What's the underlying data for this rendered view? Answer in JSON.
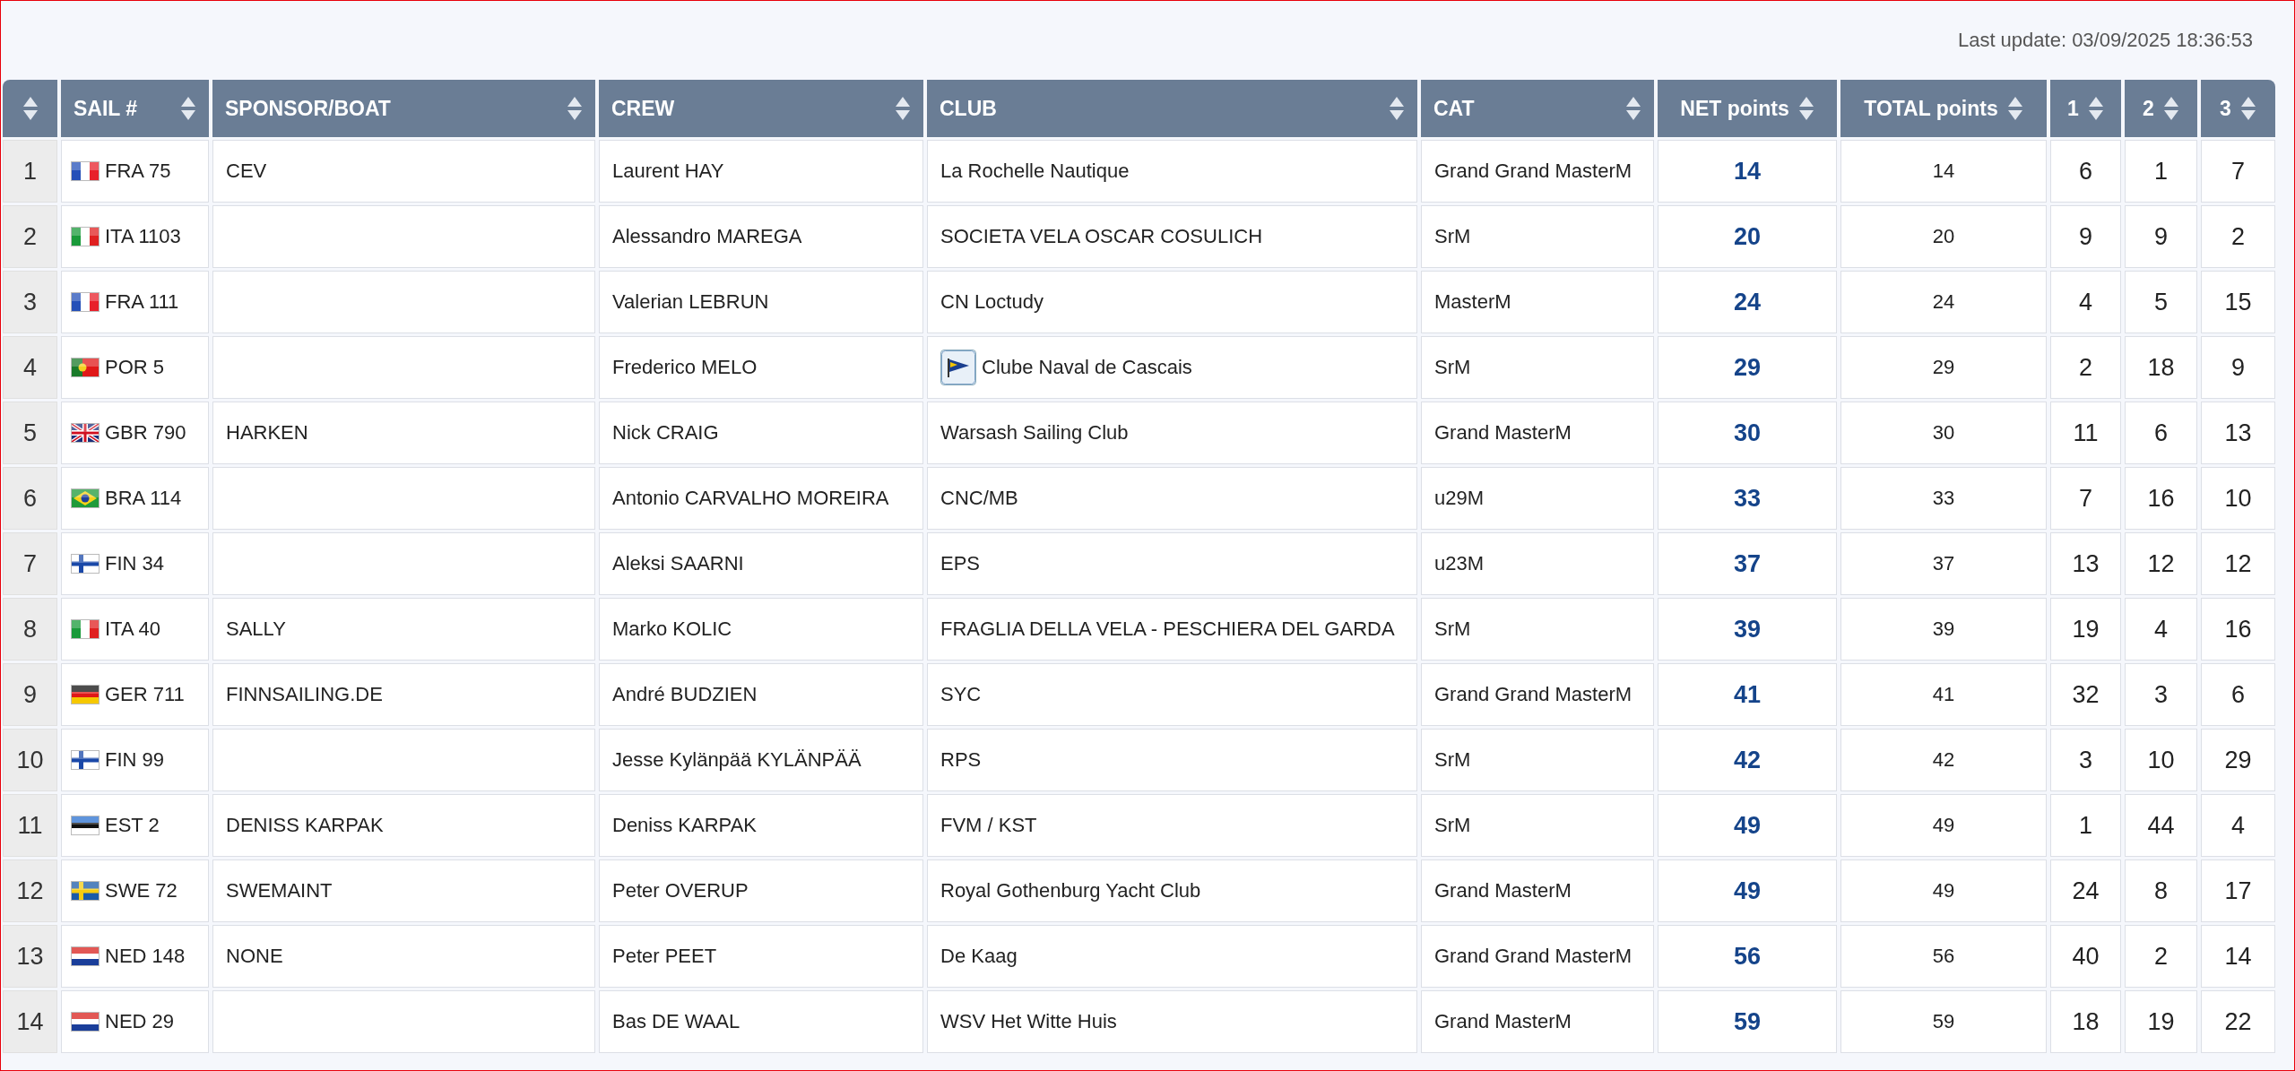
{
  "last_update": "Last update: 03/09/2025 18:36:53",
  "columns": [
    {
      "kind": "rank"
    },
    {
      "kind": "text",
      "label": "SAIL #"
    },
    {
      "kind": "text",
      "label": "SPONSOR/BOAT"
    },
    {
      "kind": "text",
      "label": "CREW"
    },
    {
      "kind": "text",
      "label": "CLUB"
    },
    {
      "kind": "text",
      "label": "CAT"
    },
    {
      "kind": "number",
      "label": "NET points"
    },
    {
      "kind": "number",
      "label": "TOTAL points"
    },
    {
      "kind": "number",
      "label": "1"
    },
    {
      "kind": "number",
      "label": "2"
    },
    {
      "kind": "number",
      "label": "3"
    }
  ],
  "rows": [
    {
      "rank": "1",
      "flag": {
        "kind": "fr"
      },
      "sail": "FRA 75",
      "sponsor": "CEV",
      "crew": "Laurent HAY",
      "club": "La Rochelle Nautique",
      "cat": "Grand Grand MasterM",
      "net": "14",
      "total": "14",
      "races": [
        "6",
        "1",
        "7"
      ]
    },
    {
      "rank": "2",
      "flag": {
        "kind": "it"
      },
      "sail": "ITA 1103",
      "crew": "Alessandro MAREGA",
      "club": "SOCIETA VELA OSCAR COSULICH",
      "cat": "SrM",
      "net": "20",
      "total": "20",
      "races": [
        "9",
        "9",
        "2"
      ]
    },
    {
      "rank": "3",
      "flag": {
        "kind": "fr"
      },
      "sail": "FRA 111",
      "crew": "Valerian LEBRUN",
      "club": "CN Loctudy",
      "cat": "MasterM",
      "net": "24",
      "total": "24",
      "races": [
        "4",
        "5",
        "15"
      ]
    },
    {
      "rank": "4",
      "flag": {
        "kind": "pt"
      },
      "sail": "POR 5",
      "crew": "Frederico MELO",
      "club": "Clube Naval de Cascais",
      "club_logo": true,
      "cat": "SrM",
      "net": "29",
      "total": "29",
      "races": [
        "2",
        "18",
        "9"
      ]
    },
    {
      "rank": "5",
      "flag": {
        "kind": "gb"
      },
      "sail": "GBR 790",
      "sponsor": "HARKEN",
      "crew": "Nick CRAIG",
      "club": "Warsash Sailing Club",
      "cat": "Grand MasterM",
      "net": "30",
      "total": "30",
      "races": [
        "11",
        "6",
        "13"
      ]
    },
    {
      "rank": "6",
      "flag": {
        "kind": "br"
      },
      "sail": "BRA 114",
      "crew": "Antonio CARVALHO MOREIRA",
      "club": "CNC/MB",
      "cat": "u29M",
      "net": "33",
      "total": "33",
      "races": [
        "7",
        "16",
        "10"
      ]
    },
    {
      "rank": "7",
      "flag": {
        "kind": "fi"
      },
      "sail": "FIN 34",
      "crew": "Aleksi SAARNI",
      "club": "EPS",
      "cat": "u23M",
      "net": "37",
      "total": "37",
      "races": [
        "13",
        "12",
        "12"
      ]
    },
    {
      "rank": "8",
      "flag": {
        "kind": "it"
      },
      "sail": "ITA 40",
      "sponsor": "SALLY",
      "crew": "Marko KOLIC",
      "club": "FRAGLIA DELLA VELA - PESCHIERA DEL GARDA",
      "cat": "SrM",
      "net": "39",
      "total": "39",
      "races": [
        "19",
        "4",
        "16"
      ]
    },
    {
      "rank": "9",
      "flag": {
        "kind": "de"
      },
      "sail": "GER 711",
      "sponsor": "FINNSAILING.DE",
      "crew": "André BUDZIEN",
      "club": "SYC",
      "cat": "Grand Grand MasterM",
      "net": "41",
      "total": "41",
      "races": [
        "32",
        "3",
        "6"
      ]
    },
    {
      "rank": "10",
      "flag": {
        "kind": "fi"
      },
      "sail": "FIN 99",
      "crew": "Jesse Kylänpää KYLÄNPÄÄ",
      "club": "RPS",
      "cat": "SrM",
      "net": "42",
      "total": "42",
      "races": [
        "3",
        "10",
        "29"
      ]
    },
    {
      "rank": "11",
      "flag": {
        "kind": "ee"
      },
      "sail": "EST 2",
      "sponsor": "DENISS KARPAK",
      "crew": "Deniss KARPAK",
      "club": "FVM / KST",
      "cat": "SrM",
      "net": "49",
      "total": "49",
      "races": [
        "1",
        "44",
        "4"
      ]
    },
    {
      "rank": "12",
      "flag": {
        "kind": "se"
      },
      "sail": "SWE 72",
      "sponsor": "SWEMAINT",
      "crew": "Peter OVERUP",
      "club": "Royal Gothenburg Yacht Club",
      "cat": "Grand MasterM",
      "net": "49",
      "total": "49",
      "races": [
        "24",
        "8",
        "17"
      ]
    },
    {
      "rank": "13",
      "flag": {
        "kind": "nl"
      },
      "sail": "NED 148",
      "sponsor": "NONE",
      "crew": "Peter PEET",
      "club": "De Kaag",
      "cat": "Grand Grand MasterM",
      "net": "56",
      "total": "56",
      "races": [
        "40",
        "2",
        "14"
      ]
    },
    {
      "rank": "14",
      "flag": {
        "kind": "nl"
      },
      "sail": "NED 29",
      "crew": "Bas DE WAAL",
      "club": "WSV Het Witte Huis",
      "cat": "Grand MasterM",
      "net": "59",
      "total": "59",
      "races": [
        "18",
        "19",
        "22"
      ]
    }
  ]
}
